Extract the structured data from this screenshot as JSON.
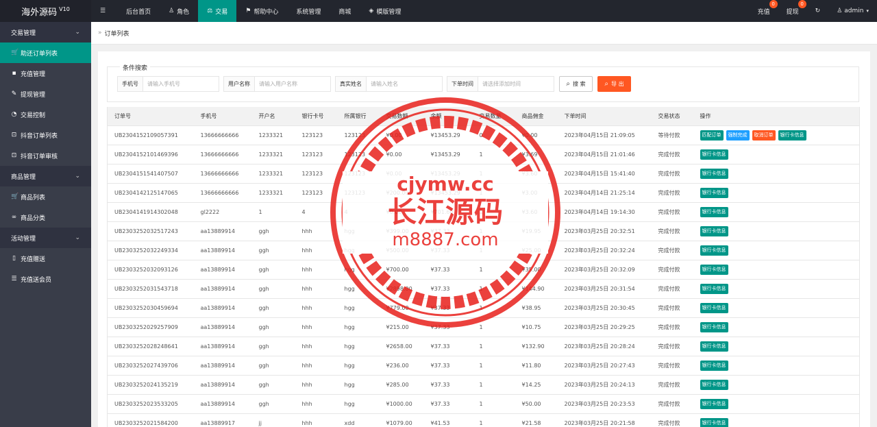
{
  "app": {
    "title": "海外源码",
    "version": "V10"
  },
  "nav": [
    {
      "icon": "menu-icon",
      "glyph": "☰",
      "label": ""
    },
    {
      "icon": "",
      "glyph": "",
      "label": "后台首页"
    },
    {
      "icon": "user-icon",
      "glyph": "♙",
      "label": "角色"
    },
    {
      "icon": "scale-icon",
      "glyph": "⚖",
      "label": "交易"
    },
    {
      "icon": "flag-icon",
      "glyph": "⚑",
      "label": "帮助中心"
    },
    {
      "icon": "",
      "glyph": "",
      "label": "系统管理"
    },
    {
      "icon": "",
      "glyph": "",
      "label": "商城"
    },
    {
      "icon": "layers-icon",
      "glyph": "◈",
      "label": "模版管理"
    }
  ],
  "nav_right": {
    "recharge": {
      "label": "充值",
      "badge": "0"
    },
    "withdraw": {
      "label": "提现",
      "badge": "0"
    },
    "refresh_glyph": "↻",
    "user": "admin"
  },
  "sidebar": {
    "groups": [
      {
        "label": "交易管理",
        "items": [
          {
            "label": "助还订单列表",
            "icon": "cart-icon",
            "glyph": "🛒",
            "active": true
          },
          {
            "label": "充值管理",
            "icon": "chat-icon",
            "glyph": "▪"
          },
          {
            "label": "提现管理",
            "icon": "gavel-icon",
            "glyph": "✎"
          },
          {
            "label": "交易控制",
            "icon": "gauge-icon",
            "glyph": "◔"
          },
          {
            "label": "抖音订单列表",
            "icon": "lock-icon",
            "glyph": "⊡"
          },
          {
            "label": "抖音订单审核",
            "icon": "lock-icon",
            "glyph": "⊡"
          }
        ]
      },
      {
        "label": "商品管理",
        "items": [
          {
            "label": "商品列表",
            "icon": "cart-icon",
            "glyph": "🛒"
          },
          {
            "label": "商品分类",
            "icon": "link-icon",
            "glyph": "∞"
          }
        ]
      },
      {
        "label": "活动管理",
        "items": [
          {
            "label": "充值赠送",
            "icon": "phone-icon",
            "glyph": "▯"
          },
          {
            "label": "充值送会员",
            "icon": "list-icon",
            "glyph": "☰"
          }
        ]
      }
    ]
  },
  "breadcrumb": {
    "sep": "»",
    "label": "订单列表"
  },
  "search": {
    "legend": "条件搜索",
    "phone": {
      "label": "手机号",
      "placeholder": "请输入手机号"
    },
    "username": {
      "label": "用户名称",
      "placeholder": "请输入用户名称"
    },
    "realname": {
      "label": "真实姓名",
      "placeholder": "请输入姓名"
    },
    "time": {
      "label": "下单时间",
      "placeholder": "请选择添加时间"
    },
    "search_btn": "搜 索",
    "export_btn": "导 出"
  },
  "table": {
    "headers": [
      "订单号",
      "手机号",
      "开户名",
      "银行卡号",
      "所属银行",
      "交易数额",
      "余额",
      "交易数量",
      "商品佣金",
      "下单时间",
      "交易状态",
      "操作"
    ],
    "rows": [
      [
        "UB2304152109057391",
        "13666666666",
        "1233321",
        "123123",
        "123123",
        "¥0.00",
        "¥13453.29",
        "0",
        "¥0.00",
        "2023年04月15日 21:09:05",
        "等待付款"
      ],
      [
        "UB2304152101469396",
        "13666666666",
        "1233321",
        "123123",
        "123123",
        "¥0.00",
        "¥13453.29",
        "1",
        "¥3.69",
        "2023年04月15日 21:01:46",
        "完成付款"
      ],
      [
        "UB2304151541407507",
        "13666666666",
        "1233321",
        "123123",
        "123123",
        "¥0.00",
        "¥13453.29",
        "1",
        "¥3.60",
        "2023年04月15日 15:41:40",
        "完成付款"
      ],
      [
        "UB2304142125147065",
        "13666666666",
        "1233321",
        "123123",
        "123123",
        "¥200.00",
        "¥13453.29",
        "1",
        "¥3.00",
        "2023年04月14日 21:25:14",
        "完成付款"
      ],
      [
        "UB2304141914302048",
        "gl2222",
        "1",
        "4",
        "4",
        "¥0.00",
        "¥701.60",
        "1",
        "¥3.60",
        "2023年04月14日 19:14:30",
        "完成付款"
      ],
      [
        "UB2303252032517243",
        "aa13889914",
        "ggh",
        "hhh",
        "hgg",
        "¥399.00",
        "¥37.33",
        "1",
        "¥19.95",
        "2023年03月25日 20:32:51",
        "完成付款"
      ],
      [
        "UB2303252032249334",
        "aa13889914",
        "ggh",
        "hhh",
        "hgg",
        "¥500.00",
        "¥37.33",
        "1",
        "¥25.00",
        "2023年03月25日 20:32:24",
        "完成付款"
      ],
      [
        "UB2303252032093126",
        "aa13889914",
        "ggh",
        "hhh",
        "hgg",
        "¥700.00",
        "¥37.33",
        "1",
        "¥35.00",
        "2023年03月25日 20:32:09",
        "完成付款"
      ],
      [
        "UB2303252031543718",
        "aa13889914",
        "ggh",
        "hhh",
        "hgg",
        "¥2898.00",
        "¥37.33",
        "1",
        "¥144.90",
        "2023年03月25日 20:31:54",
        "完成付款"
      ],
      [
        "UB2303252030459694",
        "aa13889914",
        "ggh",
        "hhh",
        "hgg",
        "¥779.00",
        "¥37.33",
        "1",
        "¥38.95",
        "2023年03月25日 20:30:45",
        "完成付款"
      ],
      [
        "UB2303252029257909",
        "aa13889914",
        "ggh",
        "hhh",
        "hgg",
        "¥215.00",
        "¥37.33",
        "1",
        "¥10.75",
        "2023年03月25日 20:29:25",
        "完成付款"
      ],
      [
        "UB2303252028248641",
        "aa13889914",
        "ggh",
        "hhh",
        "hgg",
        "¥2658.00",
        "¥37.33",
        "1",
        "¥132.90",
        "2023年03月25日 20:28:24",
        "完成付款"
      ],
      [
        "UB2303252027439706",
        "aa13889914",
        "ggh",
        "hhh",
        "hgg",
        "¥236.00",
        "¥37.33",
        "1",
        "¥11.80",
        "2023年03月25日 20:27:43",
        "完成付款"
      ],
      [
        "UB2303252024135219",
        "aa13889914",
        "ggh",
        "hhh",
        "hgg",
        "¥285.00",
        "¥37.33",
        "1",
        "¥14.25",
        "2023年03月25日 20:24:13",
        "完成付款"
      ],
      [
        "UB2303252023533205",
        "aa13889914",
        "ggh",
        "hhh",
        "hgg",
        "¥1000.00",
        "¥37.33",
        "1",
        "¥50.00",
        "2023年03月25日 20:23:53",
        "完成付款"
      ],
      [
        "UB2303252021584200",
        "aa13889917",
        "jj",
        "hhh",
        "xdd",
        "¥1079.00",
        "¥41.53",
        "1",
        "¥21.58",
        "2023年03月25日 20:21:58",
        "完成付款"
      ]
    ],
    "ops_first": [
      {
        "label": "匹配订单",
        "color": "green"
      },
      {
        "label": "强制完成",
        "color": "blue"
      },
      {
        "label": "取消订单",
        "color": "red"
      },
      {
        "label": "银行卡信息",
        "color": "green"
      }
    ],
    "ops_default": [
      {
        "label": "银行卡信息",
        "color": "green"
      }
    ]
  },
  "watermark": {
    "top": "cjymw.cc",
    "middle": "长江源码",
    "bottom": "m8887.com",
    "color": "#e8211c"
  },
  "colors": {
    "accent": "#009688",
    "topbar": "#23262e",
    "sidebar": "#393d49",
    "danger": "#ff5722",
    "info": "#1e9fff"
  }
}
